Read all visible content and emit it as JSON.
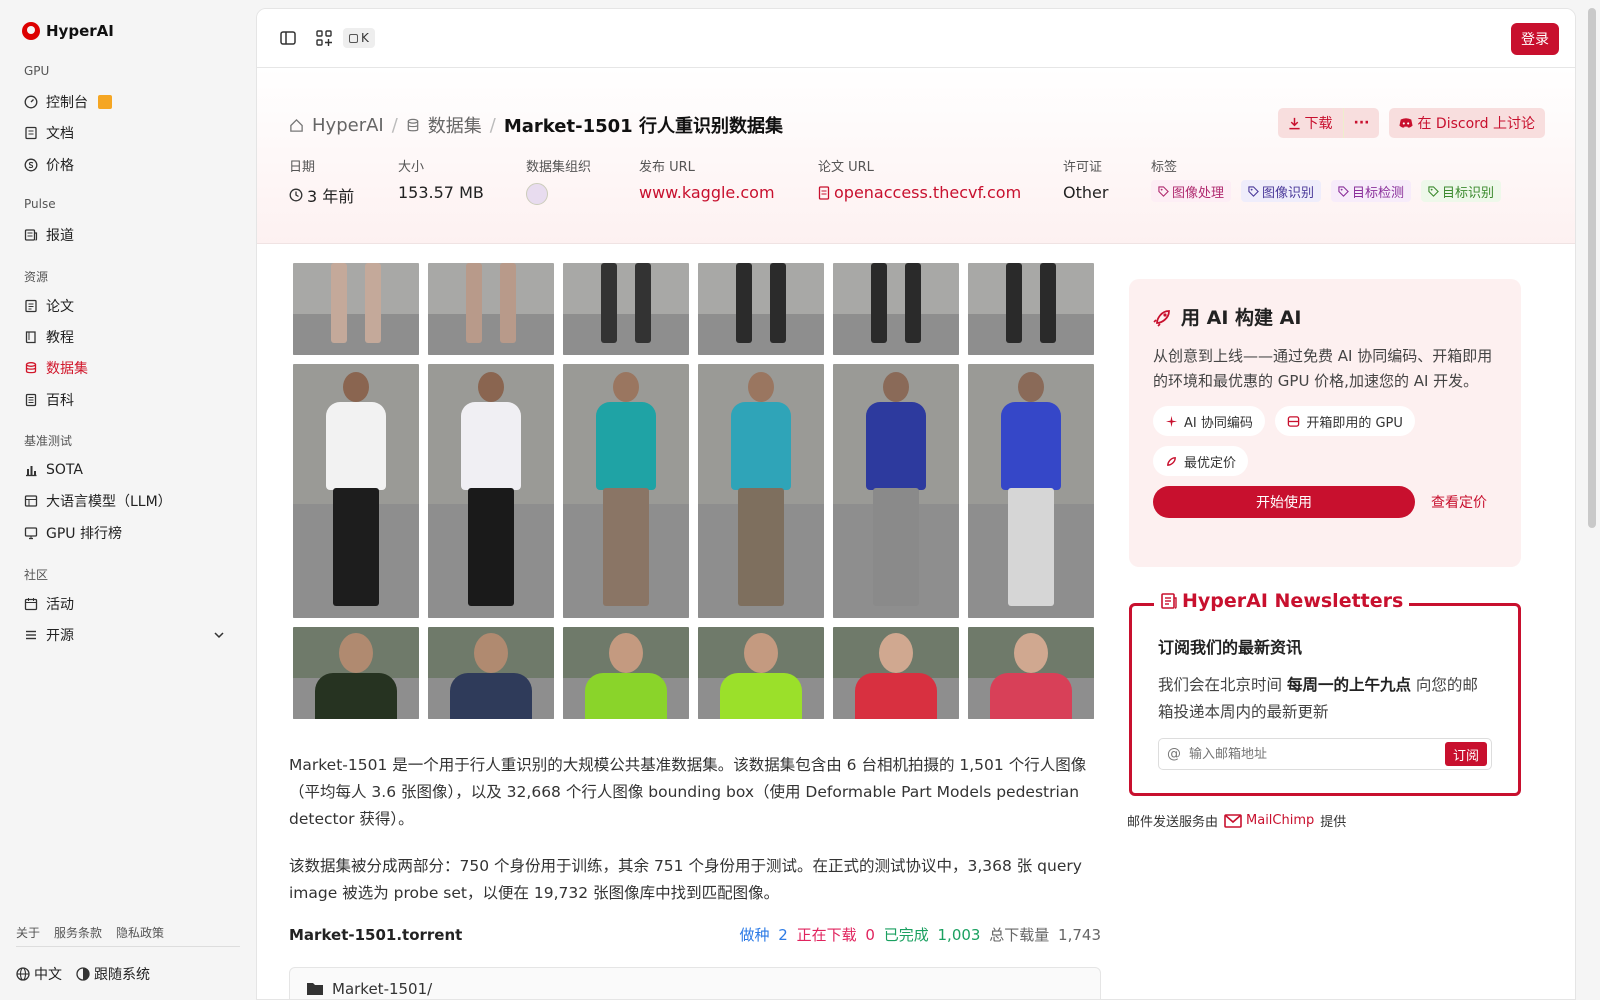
{
  "brand": {
    "name": "HyperAI",
    "color": "#d1162a"
  },
  "sidebar": {
    "sections": [
      {
        "title": "GPU",
        "items": [
          {
            "label": "控制台",
            "icon": "gauge-icon",
            "gift": true
          },
          {
            "label": "文档",
            "icon": "doc-icon"
          },
          {
            "label": "价格",
            "icon": "dollar-icon"
          }
        ]
      },
      {
        "title": "Pulse",
        "items": [
          {
            "label": "报道",
            "icon": "news-icon"
          }
        ]
      },
      {
        "title": "资源",
        "items": [
          {
            "label": "论文",
            "icon": "paper-icon"
          },
          {
            "label": "教程",
            "icon": "book-icon"
          },
          {
            "label": "数据集",
            "icon": "database-icon",
            "active": true
          },
          {
            "label": "百科",
            "icon": "wiki-icon"
          }
        ]
      },
      {
        "title": "基准测试",
        "items": [
          {
            "label": "SOTA",
            "icon": "bar-chart-icon"
          },
          {
            "label": "大语言模型（LLM）",
            "icon": "table-icon"
          },
          {
            "label": "GPU 排行榜",
            "icon": "monitor-icon"
          }
        ]
      },
      {
        "title": "社区",
        "items": [
          {
            "label": "活动",
            "icon": "calendar-icon"
          },
          {
            "label": "开源",
            "icon": "list-icon",
            "expandable": true
          }
        ]
      }
    ],
    "footer_links": [
      "关于",
      "服务条款",
      "隐私政策"
    ],
    "language": "中文",
    "theme": "跟随系统"
  },
  "topbar": {
    "kbd": "K",
    "login": "登录"
  },
  "breadcrumb": {
    "home": "HyperAI",
    "section": "数据集",
    "current": "Market-1501 行人重识别数据集"
  },
  "actions": {
    "download": "下载",
    "more": "···",
    "discord": "在 Discord 上讨论"
  },
  "meta": {
    "date": {
      "label": "日期",
      "value": "3 年前"
    },
    "size": {
      "label": "大小",
      "value": "153.57 MB"
    },
    "org": {
      "label": "数据集组织"
    },
    "publish": {
      "label": "发布 URL",
      "value": "www.kaggle.com"
    },
    "paper": {
      "label": "论文 URL",
      "value": "openaccess.thecvf.com"
    },
    "license": {
      "label": "许可证",
      "value": "Other"
    },
    "tags": {
      "label": "标签",
      "items": [
        {
          "text": "图像处理",
          "color": "#b02a6f",
          "bg": "#fdeef5"
        },
        {
          "text": "图像识别",
          "color": "#4b3a9a",
          "bg": "#efedfb"
        },
        {
          "text": "目标检测",
          "color": "#8a2f9a",
          "bg": "#f7ecfa"
        },
        {
          "text": "目标识别",
          "color": "#3c8a2e",
          "bg": "#eef8ea"
        }
      ]
    }
  },
  "description": {
    "p1": "Market-1501 是一个用于行人重识别的大规模公共基准数据集。该数据集包含由 6 台相机拍摄的 1,501 个行人图像（平均每人 3.6 张图像），以及 32,668 个行人图像 bounding box（使用 Deformable Part Models pedestrian detector 获得）。",
    "p2": "该数据集被分成两部分：750 个身份用于训练，其余 751 个身份用于测试。在正式的测试协议中，3,368 张 query image 被选为 probe set，以便在 19,732 张图像库中找到匹配图像。"
  },
  "torrent": {
    "name": "Market-1501.torrent",
    "seeding_label": "做种",
    "seeding": "2",
    "downloading_label": "正在下载",
    "downloading": "0",
    "completed_label": "已完成",
    "completed": "1,003",
    "total_label": "总下载量",
    "total": "1,743",
    "folder": "Market-1501/"
  },
  "ai_card": {
    "title": "用 AI 构建 AI",
    "text": "从创意到上线——通过免费 AI 协同编码、开箱即用的环境和最优惠的 GPU 价格,加速您的 AI 开发。",
    "pills": [
      "AI 协同编码",
      "开箱即用的 GPU",
      "最优定价"
    ],
    "cta": "开始使用",
    "pricing": "查看定价"
  },
  "newsletter": {
    "legend": "HyperAI Newsletters",
    "heading": "订阅我们的最新资讯",
    "text_pre": "我们会在北京时间",
    "text_bold": "每周一的上午九点",
    "text_post": "向您的邮箱投递本周内的最新更新",
    "placeholder": "输入邮箱地址",
    "subscribe": "订阅",
    "provided_pre": "邮件发送服务由",
    "provider": "MailChimp",
    "provided_post": "提供"
  },
  "hero_grid": [
    {
      "shirt": "#6d6d6d",
      "pants": "#c4a99a",
      "skin": "#c9a38f"
    },
    {
      "shirt": "#777",
      "pants": "#b89a8a",
      "skin": "#c9a38f"
    },
    {
      "shirt": "#555",
      "pants": "#333",
      "skin": "#b5907c"
    },
    {
      "shirt": "#666",
      "pants": "#2b2b2b",
      "skin": "#a88a78"
    },
    {
      "shirt": "#777",
      "pants": "#2a2a2a",
      "skin": "#999"
    },
    {
      "shirt": "#888",
      "pants": "#2a2a2a",
      "skin": "#aaa"
    },
    {
      "shirt": "#f2f2f2",
      "pants": "#1d1d1d",
      "skin": "#8a6550"
    },
    {
      "shirt": "#f0eff3",
      "pants": "#1a1a1a",
      "skin": "#8a6550"
    },
    {
      "shirt": "#1fa3a5",
      "pants": "#8a7565",
      "skin": "#9a7660"
    },
    {
      "shirt": "#2fa4b8",
      "pants": "#7e6f5e",
      "skin": "#9a7660"
    },
    {
      "shirt": "#2d3a9e",
      "pants": "#8a8a8a",
      "skin": "#8a6a58"
    },
    {
      "shirt": "#3547c8",
      "pants": "#d6d6d6",
      "skin": "#8a6a58"
    },
    {
      "shirt": "#263321",
      "pants": "#333",
      "skin": "#b08a70"
    },
    {
      "shirt": "#2f3b5a",
      "pants": "#333",
      "skin": "#b08a70"
    },
    {
      "shirt": "#8ad42a",
      "pants": "#333",
      "skin": "#c49a80"
    },
    {
      "shirt": "#9be02a",
      "pants": "#333",
      "skin": "#c49a80"
    },
    {
      "shirt": "#d83040",
      "pants": "#333",
      "skin": "#d0a890"
    },
    {
      "shirt": "#d84058",
      "pants": "#333",
      "skin": "#d0a890"
    }
  ]
}
